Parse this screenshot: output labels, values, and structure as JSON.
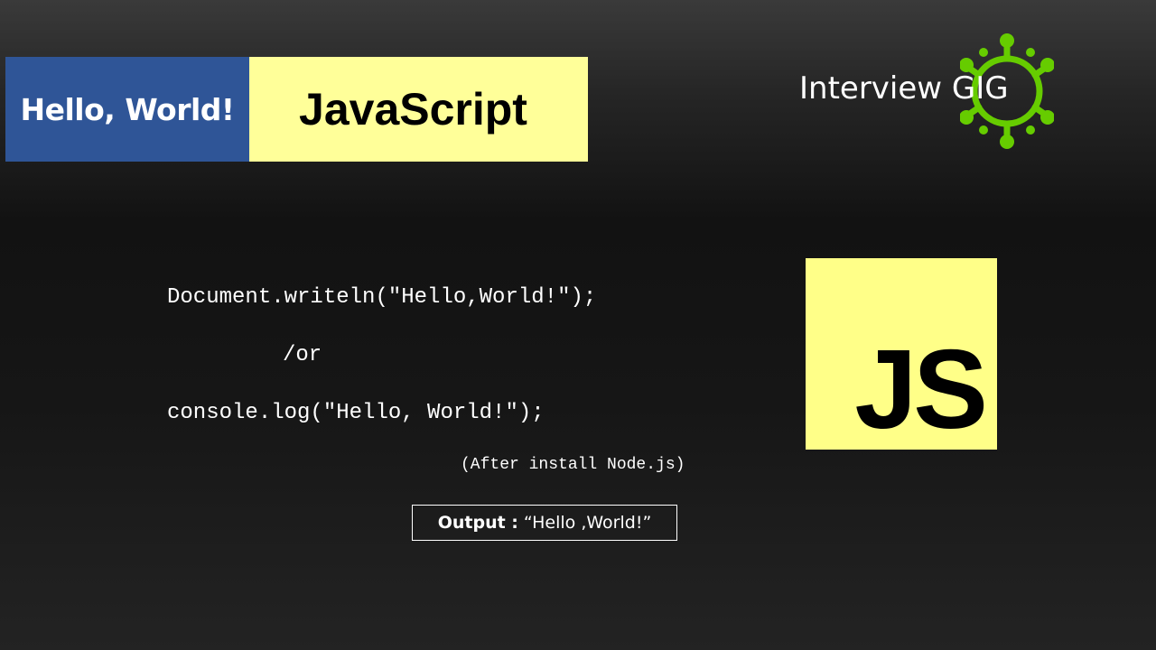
{
  "banner": {
    "left_text": "Hello, World!",
    "right_text": "JavaScript",
    "left_color": "#2f5597",
    "right_color": "#ffff99"
  },
  "brand": {
    "text": "Interview GIG",
    "gear_color": "#66cc00",
    "icon": "gear-icon"
  },
  "code": {
    "line1": "Document.writeln(\"Hello,World!\");",
    "separator": "/or",
    "line2": "console.log(\"Hello, World!\");",
    "note": "(After install Node.js)"
  },
  "output": {
    "label": "Output :",
    "value": "“Hello ,World!”"
  },
  "js_logo": {
    "text": "JS",
    "color": "#ffff88"
  }
}
